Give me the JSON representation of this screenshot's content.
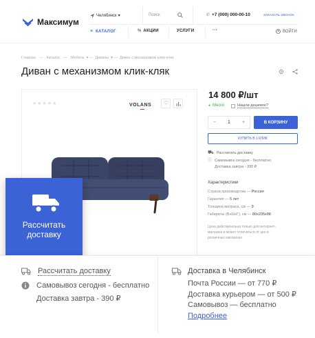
{
  "brand": {
    "name": "Максимум",
    "accent": "#3b63d6"
  },
  "header": {
    "city": "Челябинск",
    "search_placeholder": "Поиск",
    "phone": "+7 (000) 000-00-10",
    "callback": "ЗАКАЗАТЬ ЗВОНОК",
    "nav": {
      "catalog": "КАТАЛОГ",
      "promo": "АКЦИИ",
      "services": "УСЛУГИ",
      "more": "···"
    },
    "login": "ВОЙТИ"
  },
  "breadcrumbs": [
    "Главная",
    "Каталог",
    "Мебель",
    "Диваны",
    "Диван с механизмом клик-кляк"
  ],
  "product": {
    "title": "Диван с механизмом клик-кляк",
    "brand_logo": "VOLANS",
    "price": "14 800 ₽/шт",
    "stock": "Много",
    "cheaper": "Нашли дешевле?",
    "qty_minus": "−",
    "qty_value": "1",
    "qty_plus": "+",
    "cart_button": "В КОРЗИНУ",
    "one_click": "КУПИТЬ В 1 КЛИК",
    "calc_delivery": "Рассчитать доставку",
    "pickup_line1": "Самовывоз сегодня - бесплатно",
    "pickup_line2": "Доставка завтра - 390 ₽",
    "specs_title": "Характеристики",
    "specs": [
      {
        "name": "Страна производства",
        "value": "Россия"
      },
      {
        "name": "Гарантия",
        "value": "5 лет"
      },
      {
        "name": "Толщина матраса, см",
        "value": "9"
      },
      {
        "name": "Габариты (ВxШxГ), см",
        "value": "80x235x98"
      }
    ],
    "price_note_1": "Цена действительна только для интернет-",
    "price_note_2": "магазина и может отличаться от цен в",
    "price_note_3": "розничных магазинах"
  },
  "overlay": {
    "label_1": "Рассчитать",
    "label_2": "доставку",
    "icon": "truck-icon"
  },
  "panel": {
    "calc_delivery": "Рассчитать доставку",
    "pickup_today": "Самовывоз сегодня - бесплатно",
    "delivery_tomorrow": "Доставка завтра - 390 ₽",
    "delivery_city_title": "Доставка в Челябинск",
    "post": "Почта России — от 770 ₽",
    "courier": "Доставка курьером — от 500 ₽",
    "selfpickup": "Самовывоз — бесплатно",
    "more": "Подробнее"
  }
}
